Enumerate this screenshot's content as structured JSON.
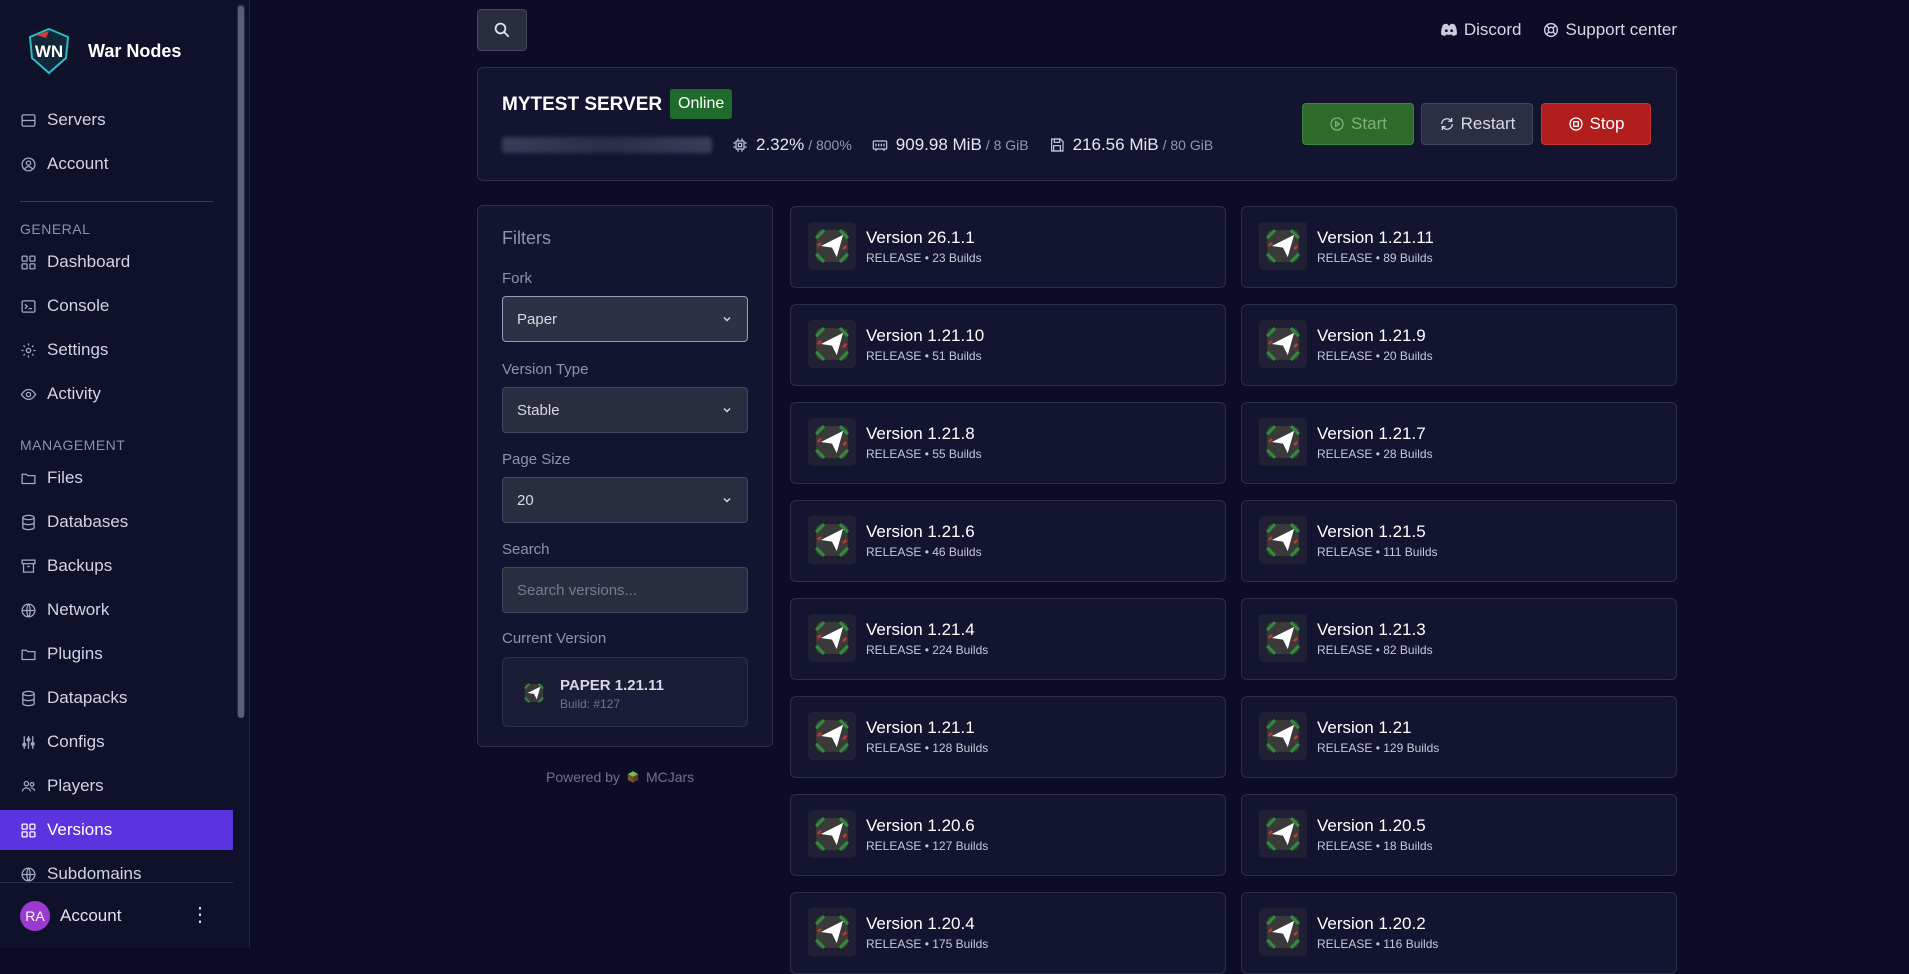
{
  "brand": {
    "name": "War Nodes",
    "logo_text": "WN"
  },
  "sidebar": {
    "top_items": [
      {
        "label": "Servers",
        "icon": "server-icon"
      },
      {
        "label": "Account",
        "icon": "account-icon"
      }
    ],
    "general_label": "GENERAL",
    "general_items": [
      {
        "label": "Dashboard",
        "icon": "dashboard-icon"
      },
      {
        "label": "Console",
        "icon": "console-icon"
      },
      {
        "label": "Settings",
        "icon": "gear-icon"
      },
      {
        "label": "Activity",
        "icon": "eye-icon"
      }
    ],
    "management_label": "MANAGEMENT",
    "management_items": [
      {
        "label": "Files",
        "icon": "folder-icon"
      },
      {
        "label": "Databases",
        "icon": "database-icon"
      },
      {
        "label": "Backups",
        "icon": "archive-icon"
      },
      {
        "label": "Network",
        "icon": "globe-icon"
      },
      {
        "label": "Plugins",
        "icon": "folder-icon"
      },
      {
        "label": "Datapacks",
        "icon": "database-icon"
      },
      {
        "label": "Configs",
        "icon": "sliders-icon"
      },
      {
        "label": "Players",
        "icon": "users-icon"
      },
      {
        "label": "Versions",
        "icon": "grid-icon",
        "active": true
      },
      {
        "label": "Subdomains",
        "icon": "globe-icon"
      }
    ],
    "account": {
      "initials": "RA",
      "label": "Account"
    }
  },
  "topbar": {
    "discord_label": "Discord",
    "support_label": "Support center"
  },
  "server": {
    "name": "MYTEST SERVER",
    "status": "Online",
    "cpu": "2.32%",
    "cpu_limit": "/ 800%",
    "memory": "909.98 MiB",
    "memory_limit": "/ 8 GiB",
    "disk": "216.56 MiB",
    "disk_limit": "/ 80 GiB",
    "start_label": "Start",
    "restart_label": "Restart",
    "stop_label": "Stop"
  },
  "filters": {
    "title": "Filters",
    "fork_label": "Fork",
    "fork_value": "Paper",
    "version_type_label": "Version Type",
    "version_type_value": "Stable",
    "page_size_label": "Page Size",
    "page_size_value": "20",
    "search_label": "Search",
    "search_placeholder": "Search versions...",
    "current_version_label": "Current Version",
    "current_version_name": "PAPER 1.21.11",
    "current_version_build": "Build: #127",
    "powered_by": "Powered by",
    "powered_brand": "MCJars"
  },
  "versions": [
    {
      "name": "Version 26.1.1",
      "meta": "RELEASE • 23 Builds"
    },
    {
      "name": "Version 1.21.11",
      "meta": "RELEASE • 89 Builds"
    },
    {
      "name": "Version 1.21.10",
      "meta": "RELEASE • 51 Builds"
    },
    {
      "name": "Version 1.21.9",
      "meta": "RELEASE • 20 Builds"
    },
    {
      "name": "Version 1.21.8",
      "meta": "RELEASE • 55 Builds"
    },
    {
      "name": "Version 1.21.7",
      "meta": "RELEASE • 28 Builds"
    },
    {
      "name": "Version 1.21.6",
      "meta": "RELEASE • 46 Builds"
    },
    {
      "name": "Version 1.21.5",
      "meta": "RELEASE • 111 Builds"
    },
    {
      "name": "Version 1.21.4",
      "meta": "RELEASE • 224 Builds"
    },
    {
      "name": "Version 1.21.3",
      "meta": "RELEASE • 82 Builds"
    },
    {
      "name": "Version 1.21.1",
      "meta": "RELEASE • 128 Builds"
    },
    {
      "name": "Version 1.21",
      "meta": "RELEASE • 129 Builds"
    },
    {
      "name": "Version 1.20.6",
      "meta": "RELEASE • 127 Builds"
    },
    {
      "name": "Version 1.20.5",
      "meta": "RELEASE • 18 Builds"
    },
    {
      "name": "Version 1.20.4",
      "meta": "RELEASE • 175 Builds"
    },
    {
      "name": "Version 1.20.2",
      "meta": "RELEASE • 116 Builds"
    }
  ],
  "colors": {
    "accent": "#5b34e0",
    "online": "#1f6b2c",
    "stop": "#b11d1d",
    "start": "#2e6a2a"
  }
}
